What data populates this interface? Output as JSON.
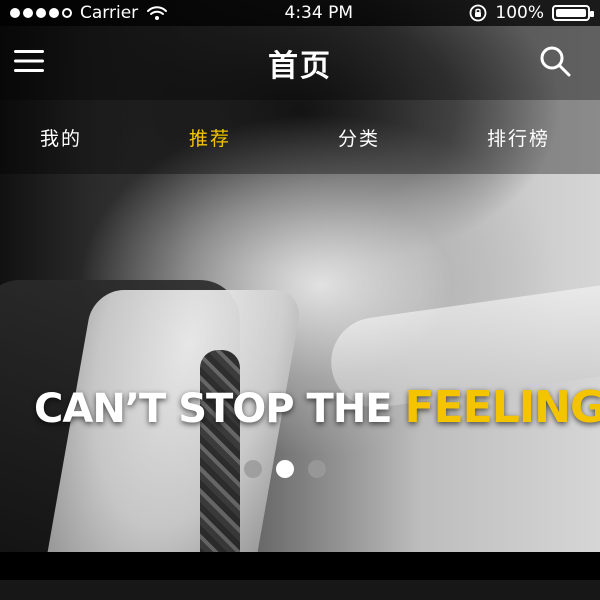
{
  "status_bar": {
    "carrier": "Carrier",
    "time": "4:34 PM",
    "battery_percent_text": "100%",
    "battery_level": 1.0,
    "signal_strength_filled": 4,
    "signal_strength_total": 5
  },
  "navbar": {
    "title": "首页"
  },
  "tabs": {
    "items": [
      {
        "label": "我的",
        "active": false
      },
      {
        "label": "推荐",
        "active": true
      },
      {
        "label": "分类",
        "active": false
      },
      {
        "label": "排行榜",
        "active": false
      }
    ]
  },
  "hero": {
    "headline": {
      "part1": "CAN’T STOP THE ",
      "part2": "FEELING",
      "part3": "!"
    },
    "pagination": {
      "count": 3,
      "active_index": 1
    }
  },
  "colors": {
    "accent": "#f5c400",
    "text": "#ffffff",
    "muted": "#9a9a9a",
    "background": "#000000"
  },
  "icons": {
    "menu": "hamburger-menu-icon",
    "search": "magnifier-search-icon",
    "wifi": "wifi-icon",
    "lock": "rotation-lock-icon",
    "battery": "battery-icon"
  }
}
